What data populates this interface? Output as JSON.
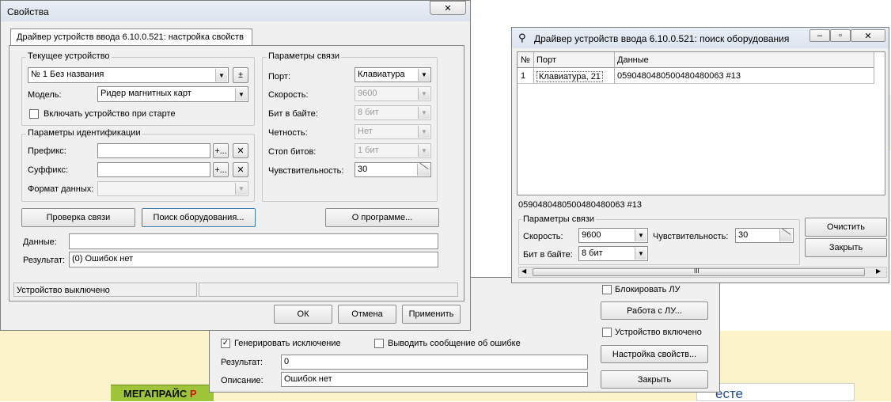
{
  "props": {
    "title": "Свойства",
    "close": "✕",
    "tab": "Драйвер устройств ввода 6.10.0.521: настройка свойств",
    "device_group": "Текущее устройство",
    "device_value": "№ 1 Без названия",
    "pm_button": "±",
    "model_label": "Модель:",
    "model_value": "Ридер магнитных карт",
    "autostart_label": "Включать устройство при старте",
    "ident_group": "Параметры идентификации",
    "prefix_label": "Префикс:",
    "suffix_label": "Суффикс:",
    "format_label": "Формат данных:",
    "plus_btn": "+...",
    "x_btn": "✕",
    "conn_group": "Параметры связи",
    "port_label": "Порт:",
    "port_value": "Клавиатура",
    "speed_label": "Скорость:",
    "speed_value": "9600",
    "bits_label": "Бит в байте:",
    "bits_value": "8 бит",
    "parity_label": "Четность:",
    "parity_value": "Нет",
    "stop_label": "Стоп битов:",
    "stop_value": "1 бит",
    "sens_label": "Чувствительность:",
    "sens_value": "30",
    "check_btn": "Проверка связи",
    "search_btn": "Поиск оборудования...",
    "about_btn": "О программе...",
    "data_label": "Данные:",
    "data_value": "",
    "result_label": "Результат:",
    "result_value": "(0) Ошибок нет",
    "status": "Устройство выключено",
    "ok": "ОК",
    "cancel": "Отмена",
    "apply": "Применить"
  },
  "search": {
    "title": "Драйвер устройств ввода 6.10.0.521: поиск оборудования",
    "col_num": "№",
    "col_port": "Порт",
    "col_data": "Данные",
    "rows": [
      {
        "num": "1",
        "port": "Клавиатура, 21",
        "data": "0590480480500480480063 #13"
      }
    ],
    "data_line": "0590480480500480480063 #13",
    "conn_group": "Параметры связи",
    "speed_label": "Скорость:",
    "speed_value": "9600",
    "sens_label": "Чувствительность:",
    "sens_value": "30",
    "bits_label": "Бит в байте:",
    "bits_value": "8 бит",
    "clear_btn": "Очистить",
    "close_btn": "Закрыть",
    "scroll_grip": "III"
  },
  "back": {
    "block_lu": "Блокировать ЛУ",
    "work_lu_btn": "Работа с ЛУ...",
    "device_on": "Устройство включено",
    "settings_btn": "Настройка свойств...",
    "close_btn": "Закрыть",
    "gen_exception": "Генерировать исключение",
    "show_error": "Выводить сообщение об ошибке",
    "result_label": "Результат:",
    "result_value": "0",
    "desc_label": "Описание:",
    "desc_value": "Ошибок нет"
  },
  "desktop": {
    "brand_black": "МЕГАПРАЙС ",
    "brand_red": "Р",
    "link_fragment": "есте"
  }
}
